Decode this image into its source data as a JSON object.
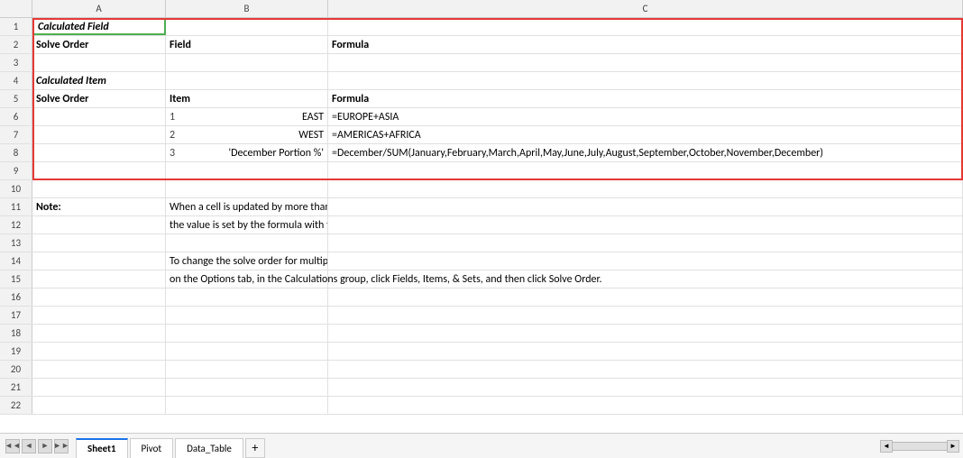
{
  "columns": {
    "a_header": "A",
    "b_header": "B",
    "c_header": "C"
  },
  "rows": [
    {
      "num": 1,
      "a": "Calculated Field",
      "b": "",
      "c": "",
      "a_bold": true,
      "a_italic": true
    },
    {
      "num": 2,
      "a": "Solve Order",
      "b": "Field",
      "c": "Formula",
      "a_bold": true,
      "b_bold": true,
      "c_bold": true
    },
    {
      "num": 3,
      "a": "",
      "b": "",
      "c": ""
    },
    {
      "num": 4,
      "a": "Calculated Item",
      "b": "",
      "c": "",
      "a_bold": true,
      "a_italic": true
    },
    {
      "num": 5,
      "a": "Solve Order",
      "b": "Item",
      "c": "Formula",
      "a_bold": true,
      "b_bold": true,
      "c_bold": true
    },
    {
      "num": 6,
      "a": "",
      "b_num": "1",
      "b": "EAST",
      "c": "=EUROPE+ASIA"
    },
    {
      "num": 7,
      "a": "",
      "b_num": "2",
      "b": "WEST",
      "c": "=AMERICAS+AFRICA"
    },
    {
      "num": 8,
      "a": "",
      "b_num": "3",
      "b": "'December Portion %'",
      "c": "=December/SUM(January,February,March,April,May,June,July,August,September,October,November,December)"
    },
    {
      "num": 9,
      "a": "",
      "b": "",
      "c": ""
    },
    {
      "num": 10,
      "a": "",
      "b": "",
      "c": ""
    },
    {
      "num": 11,
      "a": "Note:",
      "b": "When a cell is updated by more than one formula,",
      "c": "",
      "a_bold": true
    },
    {
      "num": 12,
      "a": "",
      "b": "the value is set by the formula with the last solve order.",
      "c": ""
    },
    {
      "num": 13,
      "a": "",
      "b": "",
      "c": ""
    },
    {
      "num": 14,
      "a": "",
      "b": "To change the solve order for multiple calculated items or fields,",
      "c": ""
    },
    {
      "num": 15,
      "a": "",
      "b": "on the Options tab, in the Calculations group, click Fields, Items, & Sets, and then click Solve Order.",
      "c": ""
    },
    {
      "num": 16,
      "a": "",
      "b": "",
      "c": ""
    },
    {
      "num": 17,
      "a": "",
      "b": "",
      "c": ""
    },
    {
      "num": 18,
      "a": "",
      "b": "",
      "c": ""
    },
    {
      "num": 19,
      "a": "",
      "b": "",
      "c": ""
    },
    {
      "num": 20,
      "a": "",
      "b": "",
      "c": ""
    },
    {
      "num": 21,
      "a": "",
      "b": "",
      "c": ""
    },
    {
      "num": 22,
      "a": "",
      "b": "",
      "c": ""
    }
  ],
  "tabs": [
    {
      "label": "Sheet1",
      "active": true
    },
    {
      "label": "Pivot",
      "active": false
    },
    {
      "label": "Data_Table",
      "active": false
    }
  ],
  "tab_add_label": "+",
  "nav_prev": "◄",
  "nav_next": "►"
}
